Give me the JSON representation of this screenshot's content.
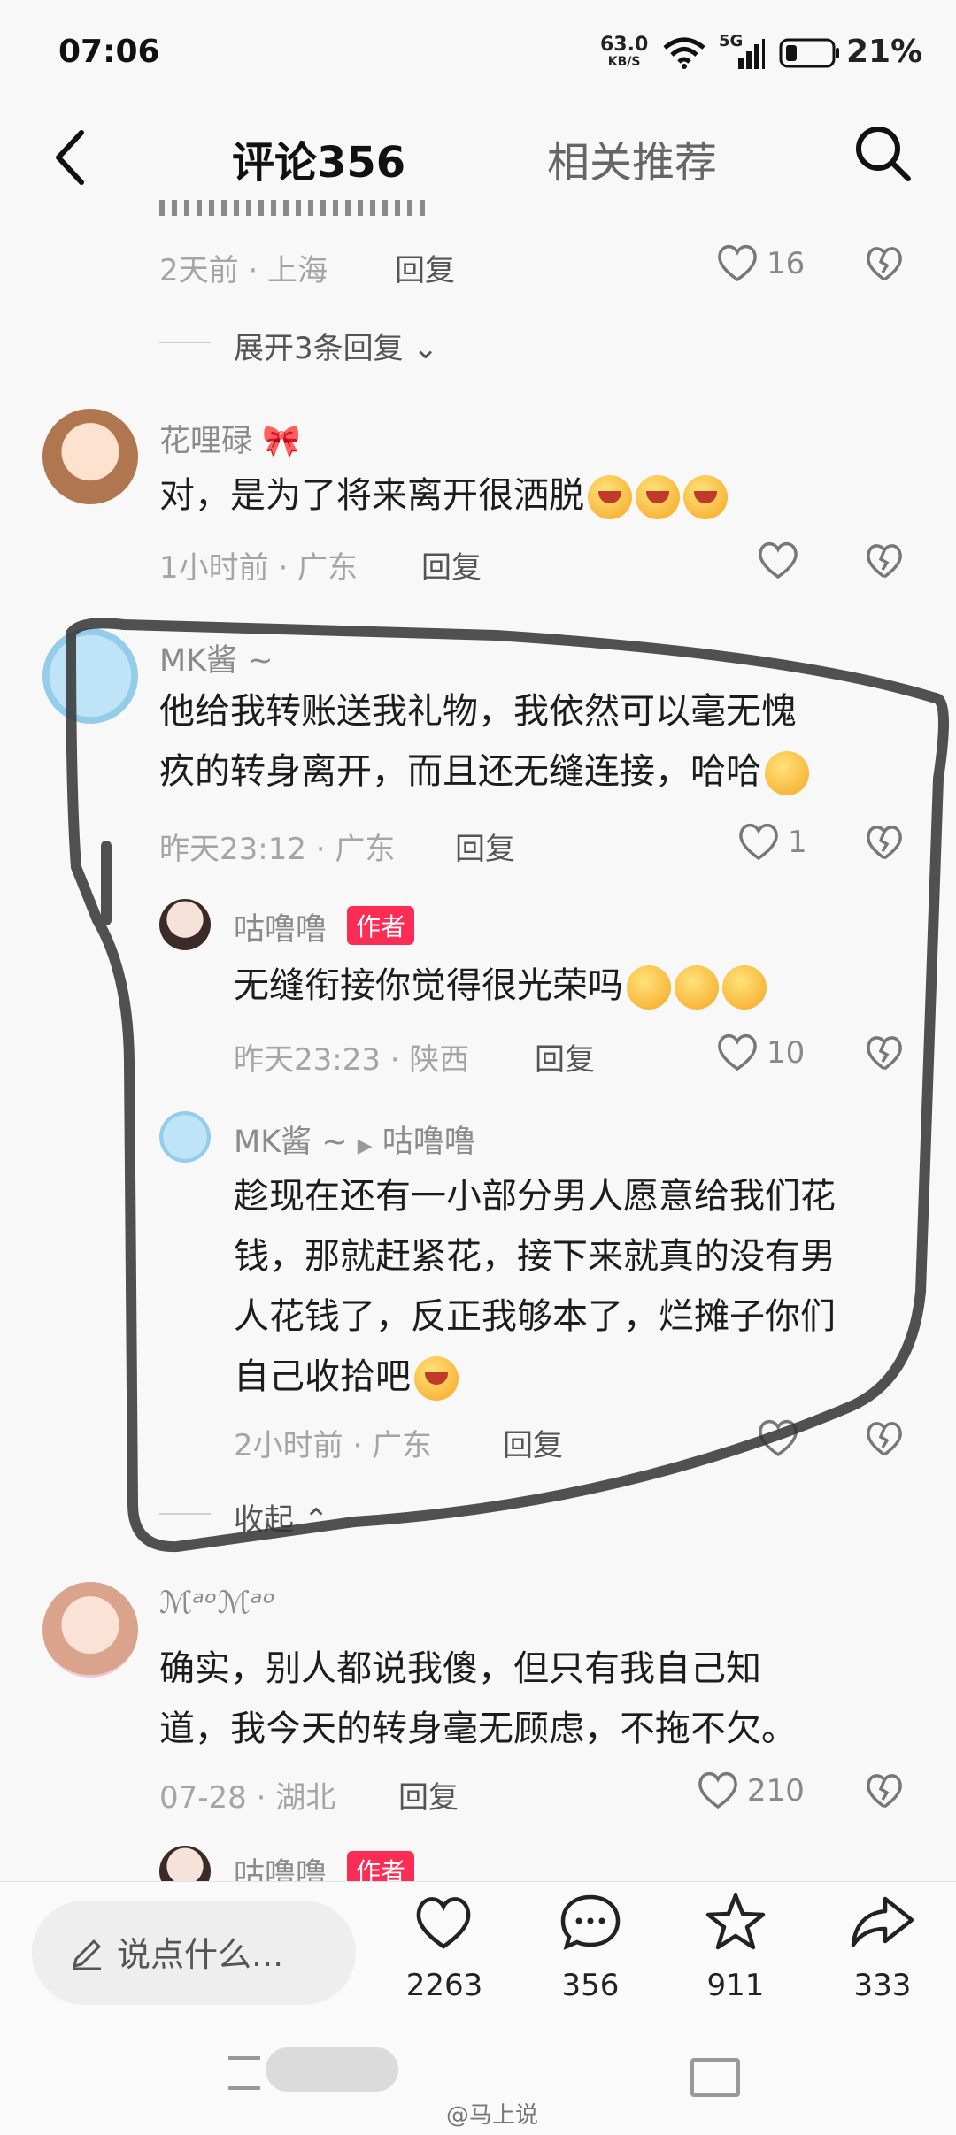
{
  "status_bar": {
    "time": "07:06",
    "net_speed": "63.0",
    "net_unit": "KB/S",
    "network": "5G",
    "battery": "21%"
  },
  "header": {
    "tab_comments": "评论356",
    "tab_related": "相关推荐"
  },
  "comments": [
    {
      "meta": "2天前 · 上海",
      "reply": "回复",
      "likes": "16",
      "expand": "展开3条回复"
    },
    {
      "user": "花哩碌",
      "text": "对，是为了将来离开很洒脱",
      "meta": "1小时前 · 广东",
      "reply": "回复"
    },
    {
      "user": "MK酱 ~",
      "text_line1": "他给我转账送我礼物，我依然可以毫无愧",
      "text_line2": "疚的转身离开，而且还无缝连接，哈哈",
      "meta": "昨天23:12 · 广东",
      "reply": "回复",
      "likes": "1",
      "replies": [
        {
          "user": "咕噜噜",
          "badge": "作者",
          "text": "无缝衔接你觉得很光荣吗",
          "meta": "昨天23:23 · 陕西",
          "reply": "回复",
          "likes": "10"
        },
        {
          "user": "MK酱 ~",
          "reply_to": "咕噜噜",
          "lines": [
            "趁现在还有一小部分男人愿意给我们花",
            "钱，那就赶紧花，接下来就真的没有男",
            "人花钱了，反正我够本了，烂摊子你们",
            "自己收拾吧"
          ],
          "meta": "2小时前 · 广东",
          "reply": "回复"
        }
      ],
      "collapse": "收起"
    },
    {
      "user": "ℳᵃᵒℳᵃᵒ",
      "text_line1": "确实，别人都说我傻，但只有我自己知",
      "text_line2": "道，我今天的转身毫无顾虑，不拖不欠。",
      "meta": "07-28 · 湖北",
      "reply": "回复",
      "likes": "210"
    },
    {
      "user": "咕噜噜",
      "badge": "作者"
    }
  ],
  "bottom_bar": {
    "input_placeholder": "说点什么...",
    "likes": "2263",
    "comments": "356",
    "favorites": "911",
    "shares": "333"
  },
  "watermark": "@马上说",
  "colors": {
    "accent": "#fb2d55",
    "background": "#f8f8f8",
    "annotation": "#333333"
  }
}
